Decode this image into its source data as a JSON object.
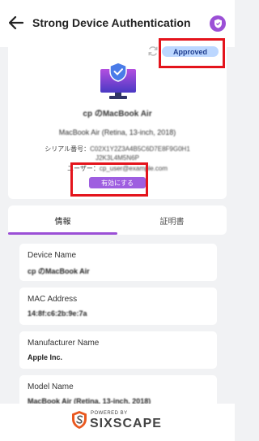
{
  "header": {
    "title": "Strong Device Authentication"
  },
  "device": {
    "status": "Approved",
    "name": "cp のMacBook Air",
    "subtitle": "MacBook Air (Retina, 13-inch, 2018)",
    "serial_label": "シリアル番号：",
    "serial_value": "C02X1Y2Z3A4B5C6D7E8F9G0H1",
    "serial_cont": "J2K3L4M5N6P",
    "user_label": "ユーザー：",
    "user_value": "cp_user@example.com",
    "enable_label": "有効にする"
  },
  "tabs": [
    {
      "label": "情報"
    },
    {
      "label": "証明書"
    }
  ],
  "fields": [
    {
      "label": "Device Name",
      "value": "cp のMacBook Air"
    },
    {
      "label": "MAC Address",
      "value": "14:8f:c6:2b:9e:7a"
    },
    {
      "label": "Manufacturer Name",
      "value": "Apple Inc."
    },
    {
      "label": "Model Name",
      "value": "MacBook Air (Retina, 13-inch, 2018)"
    }
  ],
  "footer": {
    "powered": "POWERED BY",
    "brand": "SIXSCAPE"
  },
  "colors": {
    "accent": "#9b4fd6",
    "status_bg": "#bcd7ff",
    "highlight": "#e4141c"
  },
  "icons": {
    "back": "arrow-left-icon",
    "badge": "shield-badge-icon",
    "refresh": "refresh-icon",
    "device": "monitor-shield-icon",
    "logo": "sixscape-logo-icon"
  }
}
